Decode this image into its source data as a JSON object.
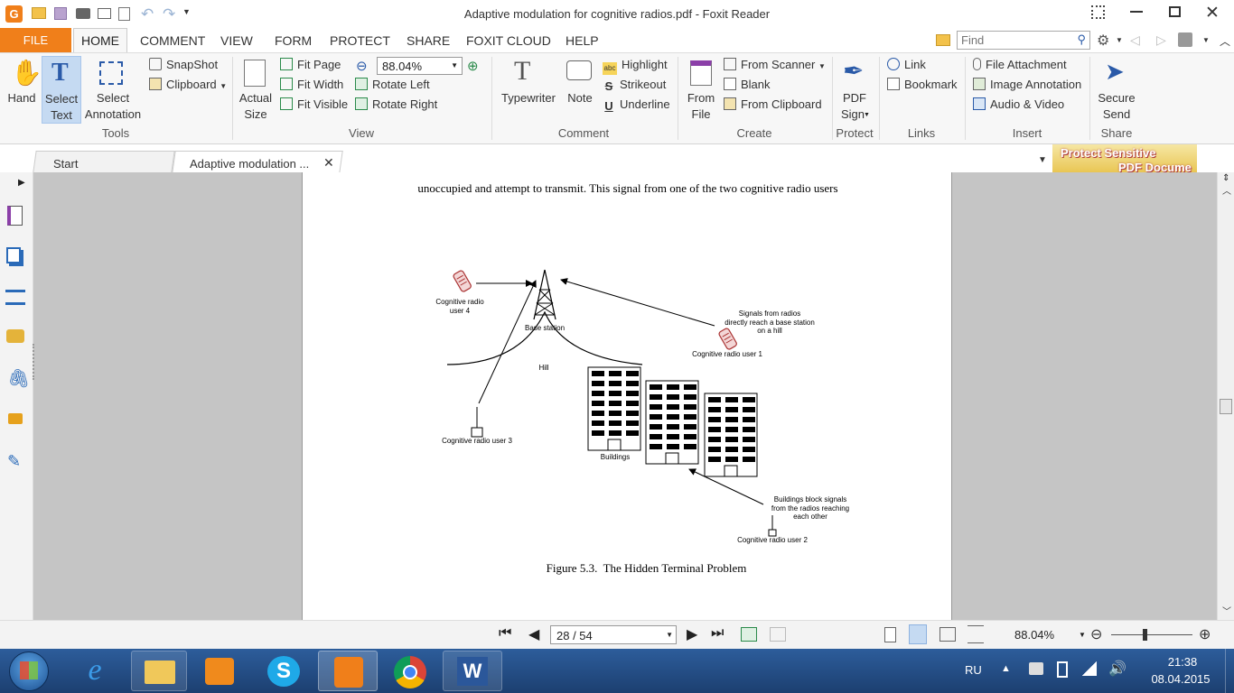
{
  "window": {
    "title": "Adaptive modulation for cognitive radios.pdf - Foxit Reader"
  },
  "menu": {
    "file": "FILE",
    "items": [
      "HOME",
      "COMMENT",
      "VIEW",
      "FORM",
      "PROTECT",
      "SHARE",
      "FOXIT CLOUD",
      "HELP"
    ]
  },
  "search": {
    "placeholder": "Find"
  },
  "ribbon": {
    "hand": "Hand",
    "select_text": [
      "Select",
      "Text"
    ],
    "select_annotation": [
      "Select",
      "Annotation"
    ],
    "snapshot": "SnapShot",
    "clipboard": "Clipboard",
    "tools_group": "Tools",
    "actual_size": [
      "Actual",
      "Size"
    ],
    "fit_page": "Fit Page",
    "fit_width": "Fit Width",
    "fit_visible": "Fit Visible",
    "zoom_value": "88.04%",
    "rotate_left": "Rotate Left",
    "rotate_right": "Rotate Right",
    "view_group": "View",
    "typewriter": "Typewriter",
    "note": "Note",
    "highlight": "Highlight",
    "strikeout": "Strikeout",
    "underline": "Underline",
    "comment_group": "Comment",
    "from_file": [
      "From",
      "File"
    ],
    "from_scanner": "From Scanner",
    "blank": "Blank",
    "from_clipboard": "From Clipboard",
    "create_group": "Create",
    "pdf_sign": [
      "PDF",
      "Sign"
    ],
    "protect_group": "Protect",
    "link": "Link",
    "bookmark": "Bookmark",
    "links_group": "Links",
    "file_attachment": "File Attachment",
    "image_annotation": "Image Annotation",
    "audio_video": "Audio & Video",
    "insert_group": "Insert",
    "secure_send": [
      "Secure",
      "Send"
    ],
    "share_group": "Share"
  },
  "tabs": [
    {
      "label": "Start"
    },
    {
      "label": "Adaptive modulation ..."
    }
  ],
  "ad_banner": [
    "Protect Sensitive",
    "PDF Docume"
  ],
  "document": {
    "top_line": "unoccupied and attempt to transmit. This signal from one of the two cognitive radio users",
    "caption": "Figure 5.3.  The Hidden Terminal Problem",
    "figure": {
      "user4": [
        "Cognitive radio",
        "user 4"
      ],
      "base_station": "Base station",
      "hill": "Hill",
      "signals_note": [
        "Signals from radios",
        "directly reach a base station",
        "on a hill"
      ],
      "user1": "Cognitive radio user 1",
      "user3": "Cognitive radio user 3",
      "buildings": "Buildings",
      "block_note": [
        "Buildings block signals",
        "from the radios reaching",
        "each other"
      ],
      "user2": "Cognitive radio user 2"
    }
  },
  "status": {
    "page": "28 / 54",
    "zoom": "88.04%"
  },
  "taskbar": {
    "lang": "RU",
    "time": "21:38",
    "date": "08.04.2015"
  }
}
